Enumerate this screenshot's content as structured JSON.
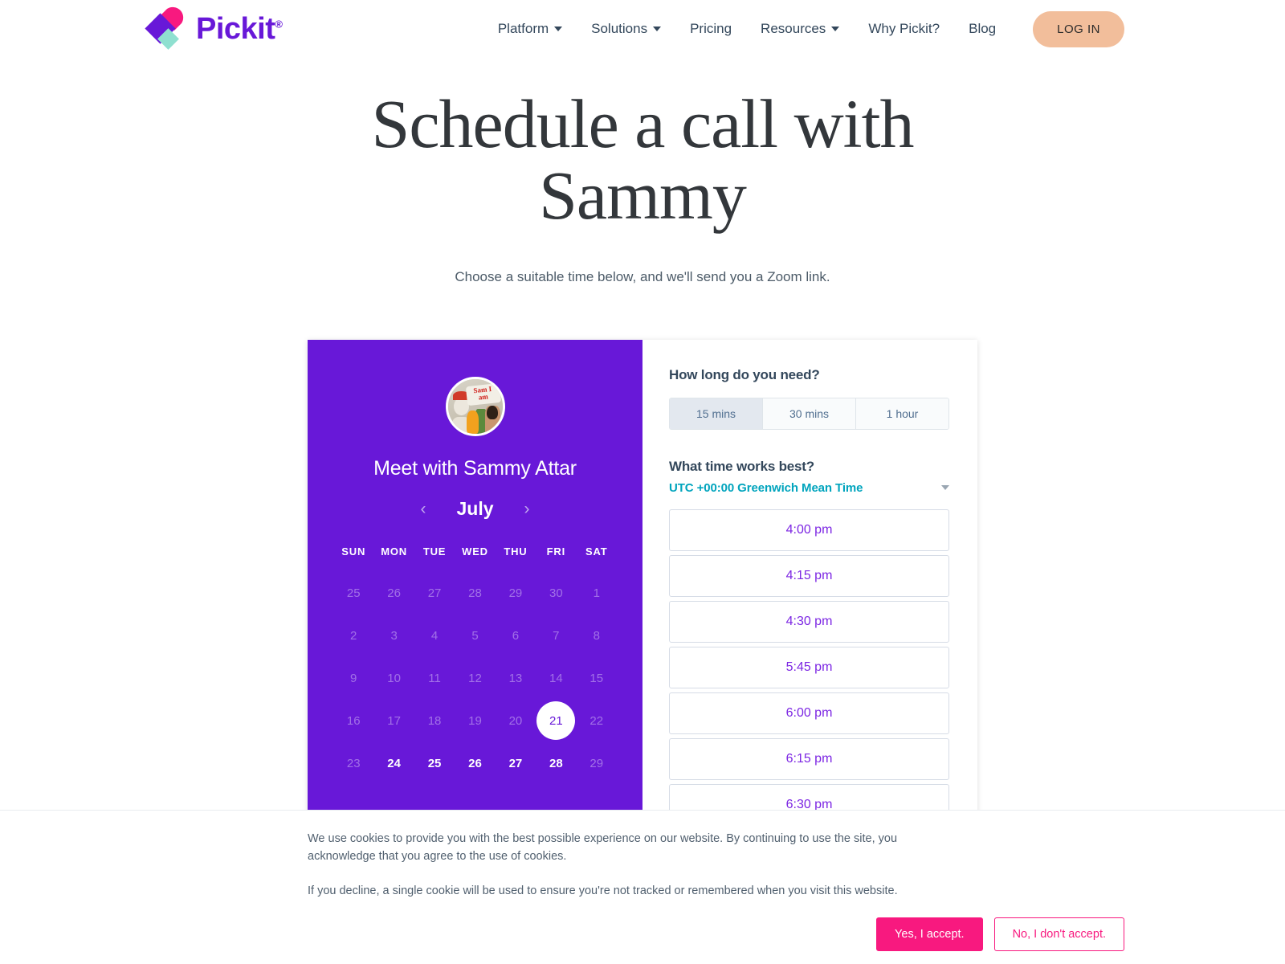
{
  "brand": {
    "name": "Pickit",
    "registered_mark": "®",
    "purple": "#6818D8",
    "pink": "#F8197F",
    "teal": "#8FE0D0",
    "peach": "#F2BE9B"
  },
  "nav": {
    "items": [
      {
        "label": "Platform",
        "has_dropdown": true
      },
      {
        "label": "Solutions",
        "has_dropdown": true
      },
      {
        "label": "Pricing",
        "has_dropdown": false
      },
      {
        "label": "Resources",
        "has_dropdown": true
      },
      {
        "label": "Why Pickit?",
        "has_dropdown": false
      },
      {
        "label": "Blog",
        "has_dropdown": false
      }
    ],
    "login_label": "LOG IN"
  },
  "hero": {
    "title": "Schedule a call with Sammy",
    "subtitle": "Choose a suitable time below, and we'll send you a Zoom link."
  },
  "calendar": {
    "avatar_alt": "Sammy Attar photo",
    "avatar_sign_text": "Sam I am",
    "meet_title": "Meet with Sammy Attar",
    "month": "July",
    "prev_arrow": "‹",
    "next_arrow": "›",
    "day_headers": [
      "SUN",
      "MON",
      "TUE",
      "WED",
      "THU",
      "FRI",
      "SAT"
    ],
    "weeks": [
      [
        {
          "n": "25",
          "state": "muted"
        },
        {
          "n": "26",
          "state": "muted"
        },
        {
          "n": "27",
          "state": "muted"
        },
        {
          "n": "28",
          "state": "muted"
        },
        {
          "n": "29",
          "state": "muted"
        },
        {
          "n": "30",
          "state": "muted"
        },
        {
          "n": "1",
          "state": "muted"
        }
      ],
      [
        {
          "n": "2",
          "state": "muted"
        },
        {
          "n": "3",
          "state": "muted"
        },
        {
          "n": "4",
          "state": "muted"
        },
        {
          "n": "5",
          "state": "muted"
        },
        {
          "n": "6",
          "state": "muted"
        },
        {
          "n": "7",
          "state": "muted"
        },
        {
          "n": "8",
          "state": "muted"
        }
      ],
      [
        {
          "n": "9",
          "state": "muted"
        },
        {
          "n": "10",
          "state": "muted"
        },
        {
          "n": "11",
          "state": "muted"
        },
        {
          "n": "12",
          "state": "muted"
        },
        {
          "n": "13",
          "state": "muted"
        },
        {
          "n": "14",
          "state": "muted"
        },
        {
          "n": "15",
          "state": "muted"
        }
      ],
      [
        {
          "n": "16",
          "state": "muted"
        },
        {
          "n": "17",
          "state": "muted"
        },
        {
          "n": "18",
          "state": "muted"
        },
        {
          "n": "19",
          "state": "muted"
        },
        {
          "n": "20",
          "state": "muted"
        },
        {
          "n": "21",
          "state": "selected"
        },
        {
          "n": "22",
          "state": "muted"
        }
      ],
      [
        {
          "n": "23",
          "state": "muted"
        },
        {
          "n": "24",
          "state": "available"
        },
        {
          "n": "25",
          "state": "available"
        },
        {
          "n": "26",
          "state": "available"
        },
        {
          "n": "27",
          "state": "available"
        },
        {
          "n": "28",
          "state": "available"
        },
        {
          "n": "29",
          "state": "muted"
        }
      ]
    ]
  },
  "booking": {
    "duration_question": "How long do you need?",
    "durations": [
      {
        "label": "15 mins",
        "selected": true
      },
      {
        "label": "30 mins",
        "selected": false
      },
      {
        "label": "1 hour",
        "selected": false
      }
    ],
    "time_question": "What time works best?",
    "timezone": "UTC +00:00 Greenwich Mean Time",
    "slots": [
      "4:00 pm",
      "4:15 pm",
      "4:30 pm",
      "5:45 pm",
      "6:00 pm",
      "6:15 pm",
      "6:30 pm",
      ""
    ]
  },
  "cookie_banner": {
    "paragraph_1": "We use cookies to provide you with the best possible experience on our website. By continuing to use the site, you acknowledge that you agree to the use of cookies.",
    "paragraph_2": "If you decline, a single cookie will be used to ensure you're not tracked or remembered when you visit this website.",
    "accept_label": "Yes, I accept.",
    "decline_label": "No, I don't accept."
  }
}
